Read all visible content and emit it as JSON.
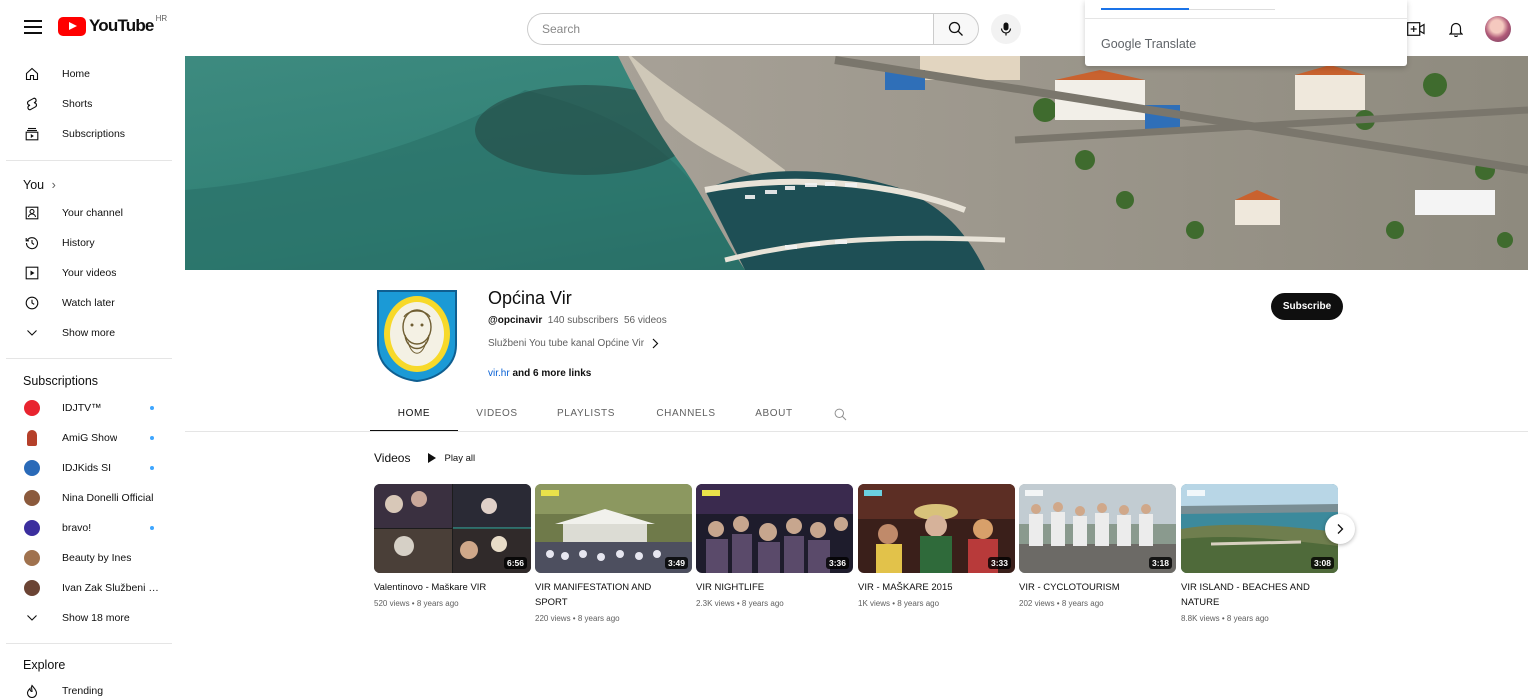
{
  "header": {
    "logo_text": "YouTube",
    "country_code": "HR",
    "search_placeholder": "Search"
  },
  "translate_popup": {
    "brand_google": "Google",
    "brand_translate": "Translate"
  },
  "sidebar": {
    "main": [
      {
        "label": "Home",
        "icon": "home-icon"
      },
      {
        "label": "Shorts",
        "icon": "shorts-icon"
      },
      {
        "label": "Subscriptions",
        "icon": "subscriptions-icon"
      }
    ],
    "you_title": "You",
    "you_chevron": "›",
    "you": [
      {
        "label": "Your channel",
        "icon": "your-channel-icon"
      },
      {
        "label": "History",
        "icon": "history-icon"
      },
      {
        "label": "Your videos",
        "icon": "your-videos-icon"
      },
      {
        "label": "Watch later",
        "icon": "watch-later-icon"
      },
      {
        "label": "Show more",
        "icon": "chevron-down-icon"
      }
    ],
    "subscriptions_title": "Subscriptions",
    "subscriptions": [
      {
        "label": "IDJTV™",
        "color": "#e8242f",
        "new": true
      },
      {
        "label": "AmiG Show",
        "color": "#b5402a",
        "new": true
      },
      {
        "label": "IDJKids SI",
        "color": "#2a6ab8",
        "new": true
      },
      {
        "label": "Nina Donelli Official",
        "color": "#8b5a3c",
        "new": false
      },
      {
        "label": "bravo!",
        "color": "#3b2e9e",
        "new": true
      },
      {
        "label": "Beauty by Ines",
        "color": "#a0724e",
        "new": false
      },
      {
        "label": "Ivan Zak Službeni k...",
        "color": "#6b4434",
        "new": false
      },
      {
        "label": "Show 18 more",
        "color": "",
        "new": false
      }
    ],
    "explore_title": "Explore",
    "explore": [
      {
        "label": "Trending",
        "icon": "trending-icon"
      }
    ]
  },
  "channel": {
    "name": "Općina Vir",
    "handle": "@opcinavir",
    "subscribers": "140 subscribers",
    "videos_count": "56 videos",
    "description": "Službeni You tube kanal Općine Vir",
    "link": "vir.hr",
    "more_links": "and 6 more links",
    "subscribe_label": "Subscribe"
  },
  "tabs": [
    "HOME",
    "VIDEOS",
    "PLAYLISTS",
    "CHANNELS",
    "ABOUT"
  ],
  "videos_section": {
    "title": "Videos",
    "play_all": "Play all"
  },
  "videos": [
    {
      "title": "Valentinovo - Maškare VIR",
      "meta": "520 views • 8 years ago",
      "duration": "6:56"
    },
    {
      "title": "VIR MANIFESTATION AND SPORT",
      "meta": "220 views • 8 years ago",
      "duration": "3:49"
    },
    {
      "title": "VIR NIGHTLIFE",
      "meta": "2.3K views • 8 years ago",
      "duration": "3:36"
    },
    {
      "title": "VIR - MAŠKARE 2015",
      "meta": "1K views • 8 years ago",
      "duration": "3:33"
    },
    {
      "title": "VIR - CYCLOTOURISM",
      "meta": "202 views • 8 years ago",
      "duration": "3:18"
    },
    {
      "title": "VIR ISLAND - BEACHES AND NATURE",
      "meta": "8.8K views • 8 years ago",
      "duration": "3:08"
    }
  ],
  "colors": {
    "brand_red": "#ff0000",
    "link_blue": "#065fd4",
    "new_dot": "#3ea6ff"
  }
}
